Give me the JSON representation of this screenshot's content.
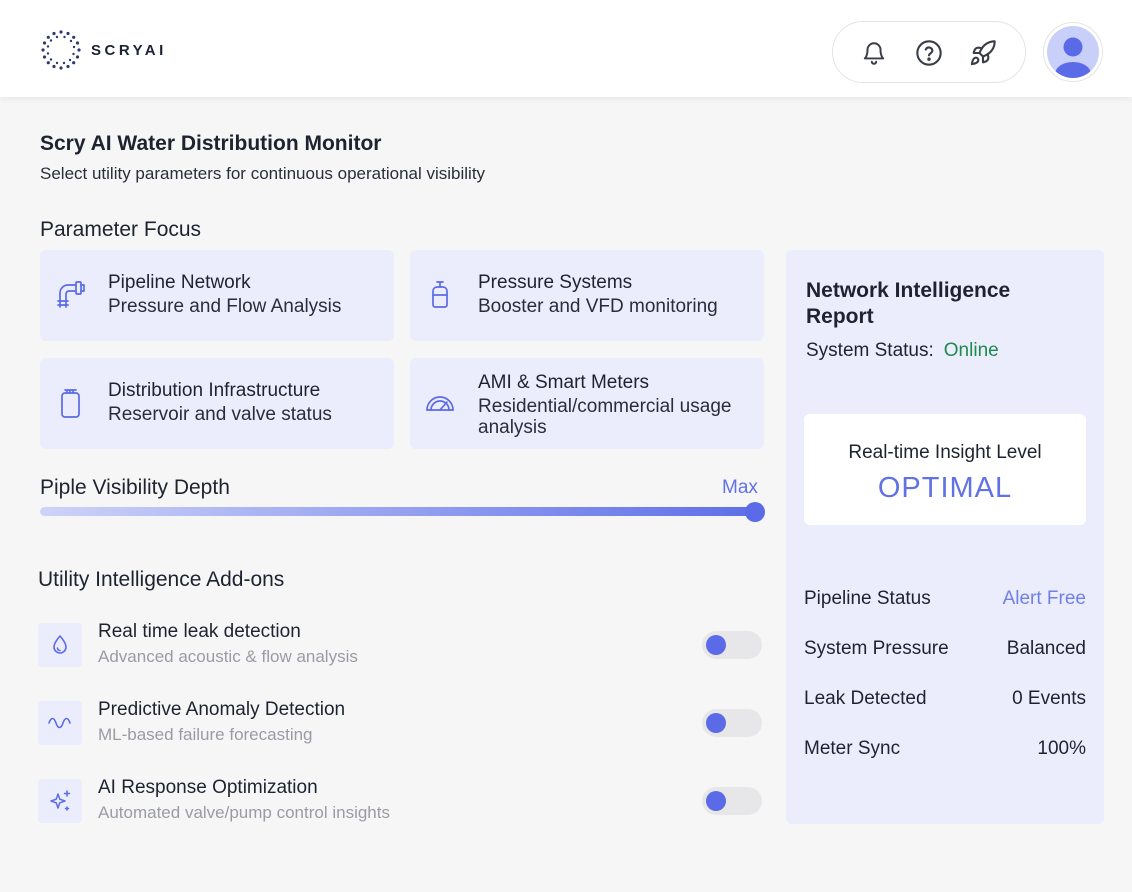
{
  "header": {
    "logo_text": "SCRYAI",
    "icons": [
      "bell-icon",
      "help-icon",
      "rocket-icon"
    ],
    "avatar_icon": "user-icon"
  },
  "page": {
    "title": "Scry AI Water Distribution Monitor",
    "subtitle": "Select utility parameters for continuous operational visibility"
  },
  "parameter_focus": {
    "heading": "Parameter Focus",
    "cards": [
      {
        "title": "Pipeline Network",
        "desc": "Pressure and Flow Analysis",
        "icon": "pipe-icon"
      },
      {
        "title": "Pressure Systems",
        "desc": "Booster and VFD monitoring",
        "icon": "tank-icon"
      },
      {
        "title": "Distribution Infrastructure",
        "desc": "Reservoir and valve status",
        "icon": "reservoir-icon"
      },
      {
        "title": "AMI & Smart Meters",
        "desc": "Residential/commercial usage analysis",
        "icon": "gauge-icon"
      }
    ]
  },
  "slider": {
    "label": "Piple Visibility Depth",
    "max_label": "Max",
    "value_fraction": 1.0
  },
  "addons": {
    "heading": "Utility Intelligence Add-ons",
    "items": [
      {
        "title": "Real time leak detection",
        "desc": "Advanced acoustic & flow analysis",
        "icon": "droplet-icon",
        "enabled": false
      },
      {
        "title": "Predictive Anomaly Detection",
        "desc": "ML-based failure forecasting",
        "icon": "wave-icon",
        "enabled": false
      },
      {
        "title": "AI Response Optimization",
        "desc": "Automated valve/pump control insights",
        "icon": "sparkles-icon",
        "enabled": false
      }
    ]
  },
  "report": {
    "title": "Network Intelligence Report",
    "status_label": "System Status:",
    "status_value": "Online",
    "insight_label": "Real-time Insight Level",
    "insight_value": "OPTIMAL",
    "metrics": [
      {
        "label": "Pipeline Status",
        "value": "Alert Free"
      },
      {
        "label": "System Pressure",
        "value": "Balanced"
      },
      {
        "label": "Leak Detected",
        "value": "0 Events"
      },
      {
        "label": "Meter Sync",
        "value": "100%"
      }
    ]
  },
  "colors": {
    "accent": "#6072e6",
    "card_bg": "#ebedfc",
    "online": "#1f8a4e",
    "background": "#f6f6f7"
  }
}
